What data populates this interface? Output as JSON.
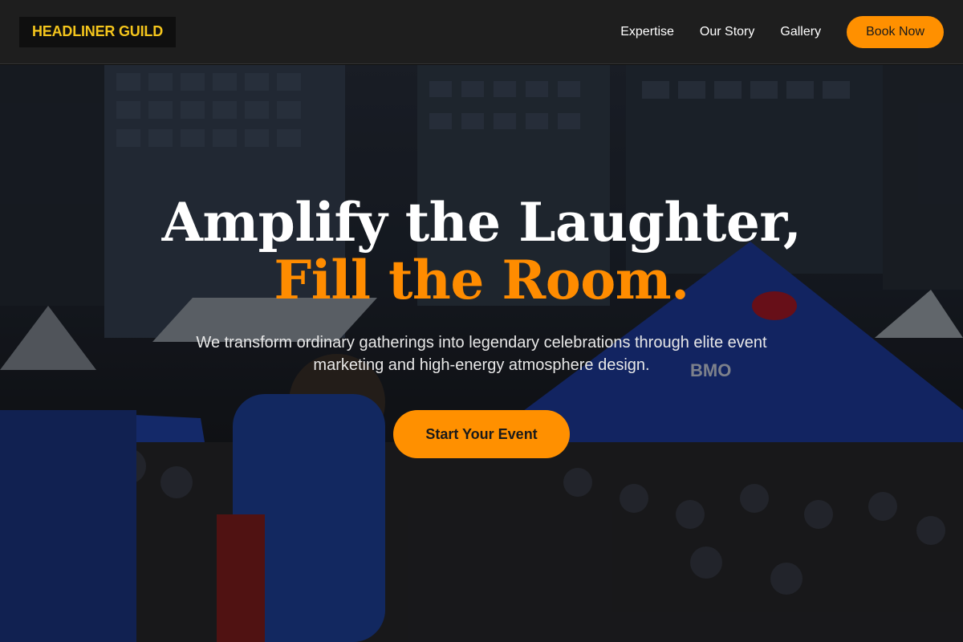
{
  "brand": {
    "name": "HEADLINER GUILD",
    "color": "#f4c51c"
  },
  "nav": {
    "links": [
      {
        "label": "Expertise"
      },
      {
        "label": "Our Story"
      },
      {
        "label": "Gallery"
      }
    ],
    "cta_label": "Book Now"
  },
  "hero": {
    "headline_part1": "Amplify the Laughter, ",
    "headline_accent": "Fill the Room.",
    "subtext": "We transform ordinary gatherings into legendary celebrations through elite event marketing and high-energy atmosphere design.",
    "cta_label": "Start Your Event",
    "background": {
      "tent_brand": "BMO"
    }
  },
  "colors": {
    "accent": "#ff9000",
    "header_bg": "#1e1e1e",
    "text": "#ffffff"
  }
}
